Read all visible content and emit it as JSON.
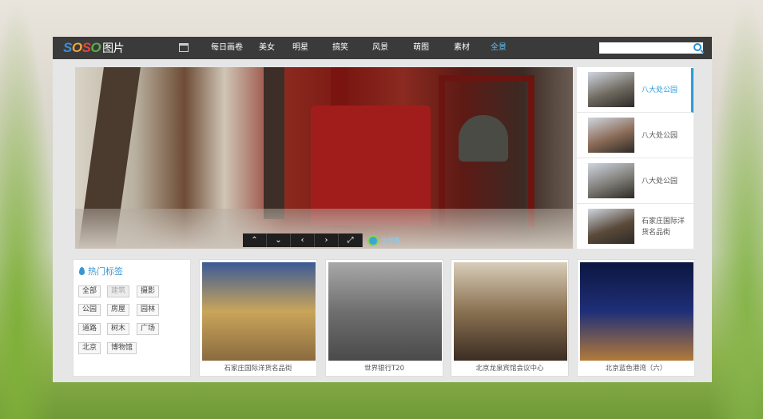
{
  "logo": {
    "s1": "S",
    "o1": "O",
    "s2": "S",
    "o2": "O",
    "cn": "图片"
  },
  "nav": [
    {
      "label": "每日画卷",
      "active": false
    },
    {
      "label": "美女",
      "active": false
    },
    {
      "label": "明星",
      "active": false
    },
    {
      "label": "搞笑",
      "active": false
    },
    {
      "label": "风景",
      "active": false
    },
    {
      "label": "萌图",
      "active": false
    },
    {
      "label": "素材",
      "active": false
    },
    {
      "label": "全景",
      "active": true
    }
  ],
  "search": {
    "placeholder": "",
    "value": ""
  },
  "pano": {
    "controls": [
      "⌃",
      "⌄",
      "‹",
      "›",
      "⤢"
    ],
    "brand": "全景客"
  },
  "side_items": [
    {
      "label": "八大处公园",
      "active": true,
      "thumb": "#6f6a60"
    },
    {
      "label": "八大处公园",
      "active": false,
      "thumb": "#8a6a56"
    },
    {
      "label": "八大处公园",
      "active": false,
      "thumb": "#7d7b75"
    },
    {
      "label": "石家庄国际洋货名品街",
      "active": false,
      "thumb": "#5a4a3a"
    }
  ],
  "tags": {
    "title": "热门标签",
    "items": [
      {
        "label": "全部",
        "dim": false
      },
      {
        "label": "建筑",
        "dim": true
      },
      {
        "label": "摄影",
        "dim": false
      },
      {
        "label": "公园",
        "dim": false
      },
      {
        "label": "房屋",
        "dim": false
      },
      {
        "label": "园林",
        "dim": false
      },
      {
        "label": "道路",
        "dim": false
      },
      {
        "label": "树木",
        "dim": false
      },
      {
        "label": "广场",
        "dim": false
      },
      {
        "label": "北京",
        "dim": false
      },
      {
        "label": "博物馆",
        "dim": false
      }
    ]
  },
  "cards": [
    {
      "caption": "石家庄国际洋货名品街",
      "colors": [
        "#3b5a96",
        "#c9a55a",
        "#8b6b3f"
      ]
    },
    {
      "caption": "世界银行T20",
      "colors": [
        "#a8a8a8",
        "#6f6f6f",
        "#4a4a4a"
      ]
    },
    {
      "caption": "北京龙泉宾馆会议中心",
      "colors": [
        "#d8cdb9",
        "#8a7152",
        "#3b2d22"
      ]
    },
    {
      "caption": "北京蓝色港湾（六）",
      "colors": [
        "#0b1640",
        "#1f2f78",
        "#b27a3a"
      ]
    }
  ]
}
